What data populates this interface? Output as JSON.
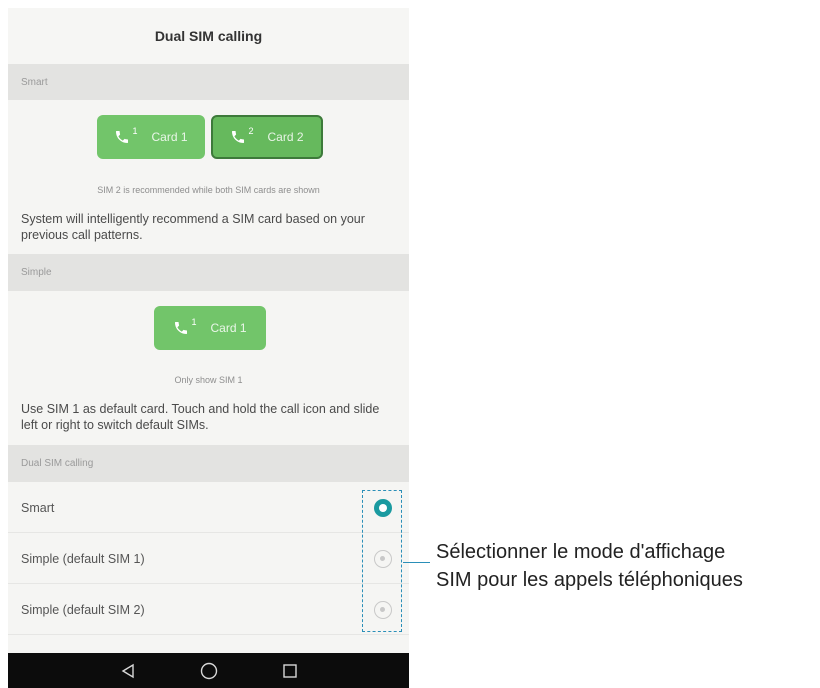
{
  "screen_title": "Dual SIM calling",
  "sections": {
    "smart": {
      "header": "Smart",
      "cards": [
        {
          "number": "1",
          "label": "Card 1"
        },
        {
          "number": "2",
          "label": "Card 2"
        }
      ],
      "caption": "SIM 2 is recommended while both SIM cards are shown",
      "description": "System will intelligently recommend a SIM card based on your previous call patterns."
    },
    "simple": {
      "header": "Simple",
      "card": {
        "number": "1",
        "label": "Card 1"
      },
      "caption": "Only show SIM 1",
      "description": "Use SIM 1 as default card. Touch and hold the call icon and slide left or right to switch default SIMs."
    },
    "dual_sim_calling": {
      "header": "Dual SIM calling",
      "options": [
        {
          "label": "Smart",
          "selected": true
        },
        {
          "label": "Simple (default SIM 1)",
          "selected": false
        },
        {
          "label": "Simple (default SIM 2)",
          "selected": false
        }
      ]
    }
  },
  "navbar": {
    "back": "back-icon",
    "home": "home-icon",
    "recents": "recents-icon"
  },
  "annotation": {
    "line1": "Sélectionner le mode d'affichage",
    "line2": "SIM pour les appels téléphoniques"
  },
  "colors": {
    "sim_button": "#72c56a",
    "radio_selected": "#1a9aa0",
    "highlight": "#2a8fb8"
  }
}
